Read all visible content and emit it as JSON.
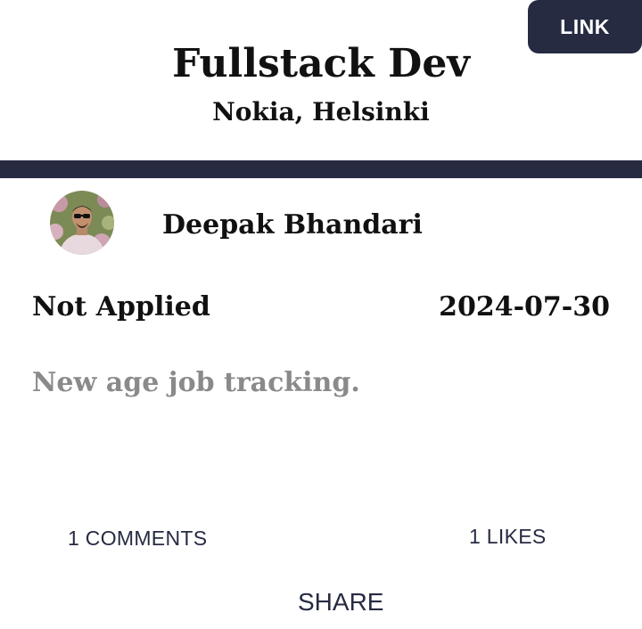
{
  "header": {
    "link_label": "LINK",
    "job_title": "Fullstack Dev",
    "company_location": "Nokia, Helsinki"
  },
  "post": {
    "author_name": "Deepak Bhandari",
    "status": "Not Applied",
    "date": "2024-07-30",
    "description": "New age job tracking."
  },
  "actions": {
    "comments_label": "1 COMMENTS",
    "likes_label": "1 LIKES",
    "share_label": "SHARE"
  },
  "colors": {
    "accent": "#262b42",
    "description_text": "#8a8a8a"
  }
}
